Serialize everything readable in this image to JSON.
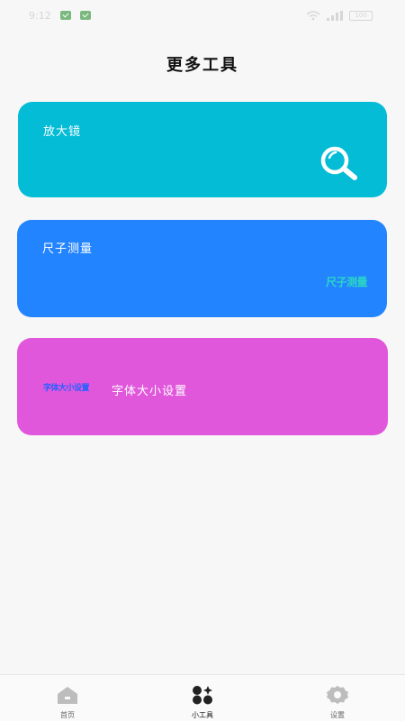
{
  "status_bar": {
    "time": "9:12",
    "battery": "100"
  },
  "page": {
    "title": "更多工具"
  },
  "cards": [
    {
      "label": "放大镜",
      "icon": "magnifier-icon",
      "color": "#04bcd6"
    },
    {
      "label": "尺子测量",
      "logo_text": "尺子测量",
      "color": "#2284ff"
    },
    {
      "label": "字体大小设置",
      "logo_text": "字体大小设置",
      "color": "#e157dc"
    }
  ],
  "tab_bar": {
    "tabs": [
      {
        "label": "首页",
        "icon": "home-icon",
        "active": false
      },
      {
        "label": "小工具",
        "icon": "tools-icon",
        "active": true
      },
      {
        "label": "设置",
        "icon": "gear-icon",
        "active": false
      }
    ]
  }
}
